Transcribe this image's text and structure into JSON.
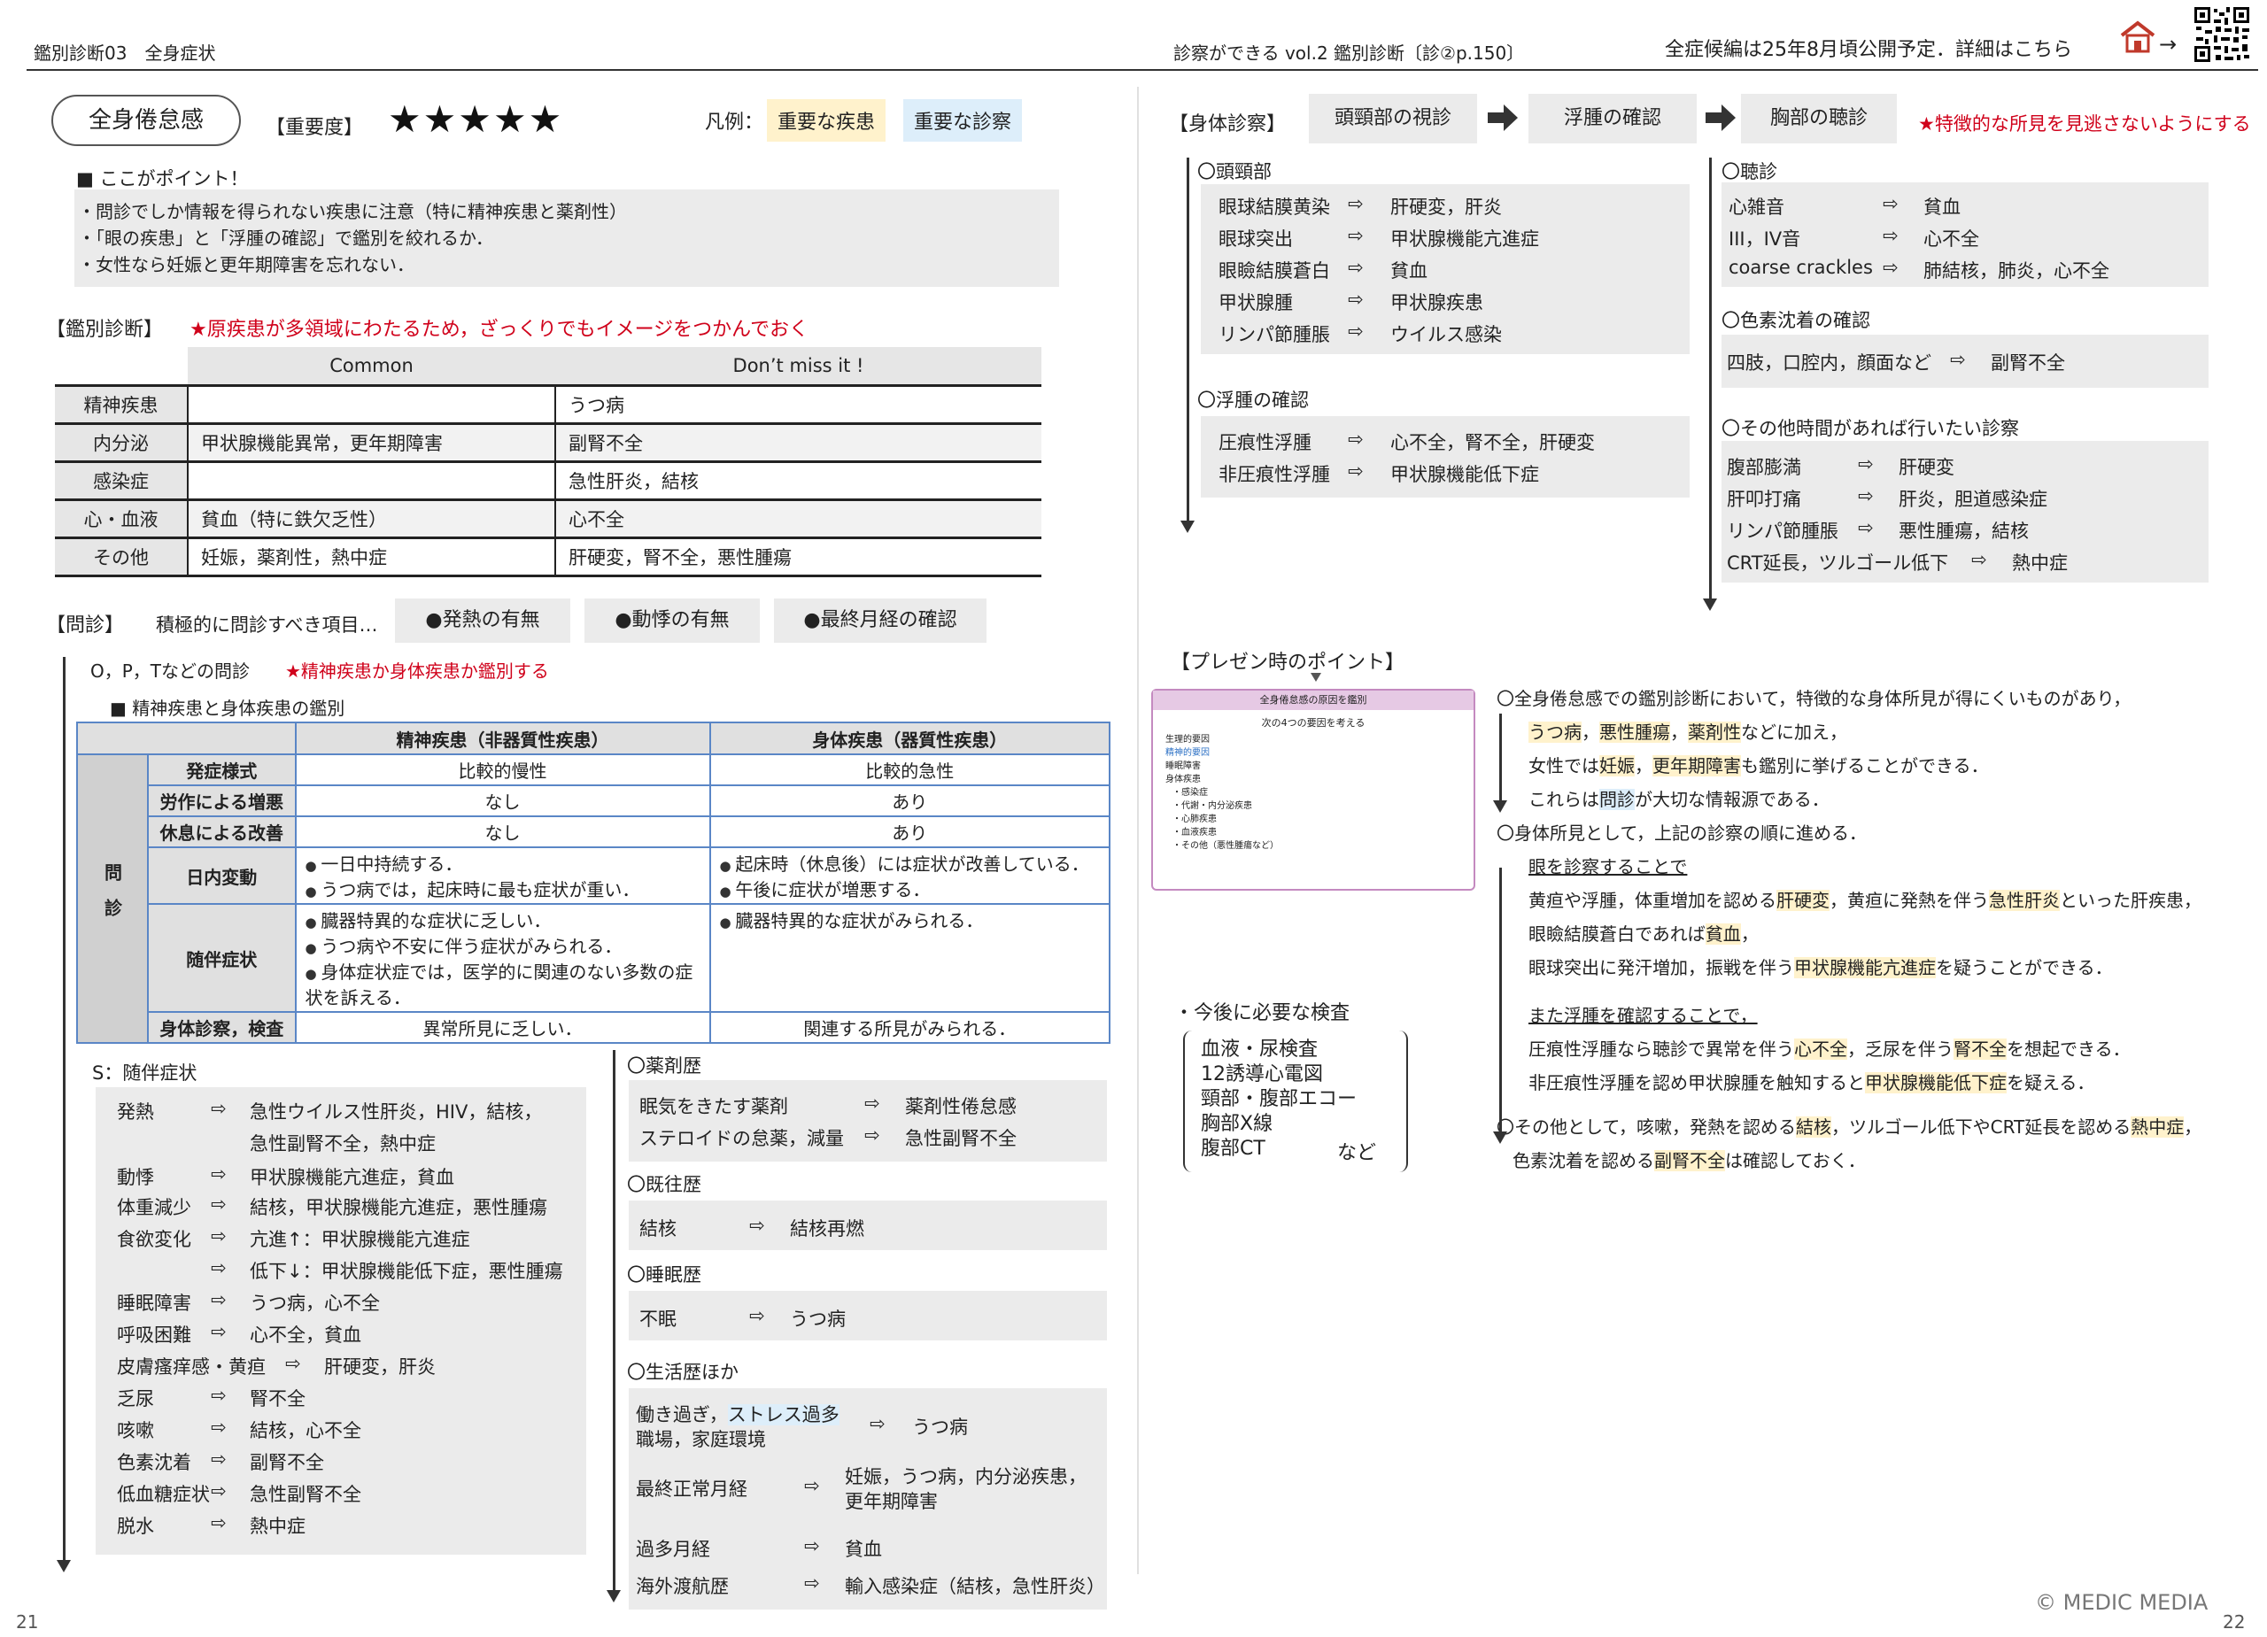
{
  "header": {
    "left": "鑑別診断03　全身症状",
    "center": "診察ができる vol.2 鑑別診断〔診②p.150〕",
    "right": "全症候編は25年8月頃公開予定．詳細はこちら",
    "arrow": "→",
    "qr_icon": "qr-code-icon",
    "logo_icon": "house-logo-icon"
  },
  "title": {
    "name": "全身倦怠感",
    "importance_label": "【重要度】",
    "stars": "★★★★★",
    "legend_label": "凡例：",
    "legend_disease": "重要な疾患",
    "legend_exam": "重要な診察"
  },
  "points": {
    "heading": "■ ここがポイント！",
    "items": [
      "・問診でしか情報を得られない疾患に注意（特に精神疾患と薬剤性）",
      "・「眼の疾患」と「浮腫の確認」で鑑別を絞れるか．",
      "・女性なら妊娠と更年期障害を忘れない．"
    ]
  },
  "ddx": {
    "heading": "【鑑別診断】",
    "note": "★原疾患が多領域にわたるため，ざっくりでもイメージをつかんでおく",
    "col_common": "Common",
    "col_dontmiss": "Don’t miss it !",
    "rows": [
      {
        "cat": "精神疾患",
        "common": "",
        "dontmiss": "うつ病"
      },
      {
        "cat": "内分泌",
        "common": "甲状腺機能異常，更年期障害",
        "dontmiss": "副腎不全"
      },
      {
        "cat": "感染症",
        "common": "",
        "dontmiss": "急性肝炎，結核"
      },
      {
        "cat": "心・血液",
        "common": "貧血（特に鉄欠乏性）",
        "dontmiss": "心不全"
      },
      {
        "cat": "その他",
        "common": "妊娠，薬剤性，熱中症",
        "dontmiss": "肝硬変，腎不全，悪性腫瘍"
      }
    ]
  },
  "interview": {
    "heading": "【問診】",
    "lead": "積極的に問診すべき項目…",
    "items": [
      "●発熱の有無",
      "●動悸の有無",
      "●最終月経の確認"
    ],
    "opqrst": "O，P，Tなどの問診",
    "opqrst_note": "★精神疾患か身体疾患か鑑別する",
    "subheading": "■ 精神疾患と身体疾患の鑑別"
  },
  "psy_table": {
    "col_psy": "精神疾患（非器質性疾患）",
    "col_body": "身体疾患（器質性疾患）",
    "group_label": "問診",
    "rows": [
      {
        "label": "発症様式",
        "psy": "比較的慢性",
        "body": "比較的急性"
      },
      {
        "label": "労作による増悪",
        "psy": "なし",
        "body": "あり"
      },
      {
        "label": "休息による改善",
        "psy": "なし",
        "body": "あり"
      }
    ],
    "diurnal": {
      "label": "日内変動",
      "psy": [
        "一日中持続する．",
        "うつ病では，起床時に最も症状が重い．"
      ],
      "body": [
        "起床時（休息後）には症状が改善している．",
        "午後に症状が増悪する．"
      ]
    },
    "associated": {
      "label": "随伴症状",
      "psy": [
        "臓器特異的な症状に乏しい．",
        "うつ病や不安に伴う症状がみられる．",
        "身体症状症では，医学的に関連のない多数の症状を訴える．"
      ],
      "body": [
        "臓器特異的な症状がみられる．"
      ]
    },
    "exam": {
      "label": "身体診察，検査",
      "psy": "異常所見に乏しい．",
      "body": "関連する所見がみられる．"
    }
  },
  "symptoms": {
    "heading": "S：随伴症状",
    "arrow": "⇨",
    "rows": [
      {
        "k": "発熱",
        "v": "急性ウイルス性肝炎，HIV，結核，"
      },
      {
        "k": "",
        "v": "急性副腎不全，熱中症"
      },
      {
        "k": "動悸",
        "v": "甲状腺機能亢進症，貧血"
      },
      {
        "k": "体重減少",
        "v": "結核，甲状腺機能亢進症，悪性腫瘍"
      },
      {
        "k": "食欲変化",
        "v": "亢進↑：甲状腺機能亢進症"
      },
      {
        "k": "",
        "v": "低下↓：甲状腺機能低下症，悪性腫瘍"
      },
      {
        "k": "睡眠障害",
        "v": "うつ病，心不全"
      },
      {
        "k": "呼吸困難",
        "v": "心不全，貧血"
      },
      {
        "k": "皮膚瘙痒感・黄疸",
        "v": "肝硬変，肝炎"
      },
      {
        "k": "乏尿",
        "v": "腎不全"
      },
      {
        "k": "咳嗽",
        "v": "結核，心不全"
      },
      {
        "k": "色素沈着",
        "v": "副腎不全"
      },
      {
        "k": "低血糖症状",
        "v": "急性副腎不全"
      },
      {
        "k": "脱水",
        "v": "熱中症"
      }
    ]
  },
  "history": {
    "drug_h": "〇薬剤歴",
    "drug": [
      {
        "k": "眠気をきたす薬剤",
        "v": "薬剤性倦怠感"
      },
      {
        "k": "ステロイドの怠薬，減量",
        "v": "急性副腎不全"
      }
    ],
    "past_h": "〇既往歴",
    "past": [
      {
        "k": "結核",
        "v": "結核再燃"
      }
    ],
    "sleep_h": "〇睡眠歴",
    "sleep": [
      {
        "k": "不眠",
        "v": "うつ病"
      }
    ],
    "life_h": "〇生活歴ほか",
    "life1_a": "働き過ぎ，",
    "life1_b": "ストレス過多",
    "life1_c": "職場，家庭環境",
    "life1_v": "うつ病",
    "life2_k": "最終正常月経",
    "life2_v1": "妊娠，うつ病，内分泌疾患，",
    "life2_v2": "更年期障害",
    "life3_k": "過多月経",
    "life3_v": "貧血",
    "life4_k": "海外渡航歴",
    "life4_v": "輸入感染症（結核，急性肝炎）"
  },
  "exam": {
    "heading": "【身体診察】",
    "steps": [
      "頭頸部の視診",
      "浮腫の確認",
      "胸部の聴診"
    ],
    "note": "★特徴的な所見を見逃さないようにする",
    "head_h": "〇頭頸部",
    "head": [
      {
        "k": "眼球結膜黄染",
        "v": "肝硬変，肝炎"
      },
      {
        "k": "眼球突出",
        "v": "甲状腺機能亢進症"
      },
      {
        "k": "眼瞼結膜蒼白",
        "v": "貧血"
      },
      {
        "k": "甲状腺腫",
        "v": "甲状腺疾患"
      },
      {
        "k": "リンパ節腫脹",
        "v": "ウイルス感染"
      }
    ],
    "edema_h": "〇浮腫の確認",
    "edema": [
      {
        "k": "圧痕性浮腫",
        "v": "心不全，腎不全，肝硬変"
      },
      {
        "k": "非圧痕性浮腫",
        "v": "甲状腺機能低下症"
      }
    ],
    "ausc_h": "〇聴診",
    "ausc": [
      {
        "k": "心雑音",
        "v": "貧血"
      },
      {
        "k": "III，IV音",
        "v": "心不全"
      },
      {
        "k": "coarse crackles",
        "v": "肺結核，肺炎，心不全"
      }
    ],
    "pig_h": "〇色素沈着の確認",
    "pig": {
      "k": "四肢，口腔内，顔面など",
      "v": "副腎不全"
    },
    "other_h": "〇その他時間があれば行いたい診察",
    "other": [
      {
        "k": "腹部膨満",
        "v": "肝硬変"
      },
      {
        "k": "肝叩打痛",
        "v": "肝炎，胆道感染症"
      },
      {
        "k": "リンパ節腫脹",
        "v": "悪性腫瘍，結核"
      },
      {
        "k": "CRT延長，ツルゴール低下",
        "v": "熱中症"
      }
    ]
  },
  "presen": {
    "heading": "【プレゼン時のポイント】",
    "slide_title": "全身倦怠感の原因を鑑別",
    "slide_sub": "次の4つの要因を考える",
    "slide_items": [
      "生理的要因",
      "精神的要因",
      "睡眠障害",
      "身体疾患",
      "・感染症",
      "・代謝・内分泌疾患",
      "・心肺疾患",
      "・血液疾患",
      "・その他（悪性腫瘍など）"
    ],
    "p1_a": "〇全身倦怠感での鑑別診断において，特徴的な身体所見が得にくいものがあり，",
    "p1_b1": "うつ病",
    "p1_b2": "悪性腫瘍",
    "p1_b3": "薬剤性",
    "p1_b4": "などに加え，",
    "p1_c1": "女性では",
    "p1_c2": "妊娠",
    "p1_c3": "更年期障害",
    "p1_c4": "も鑑別に挙げることができる．",
    "p1_d1": "これらは",
    "p1_d2": "問診",
    "p1_d3": "が大切な情報源である．",
    "p2_a": "〇身体所見として，上記の診察の順に進める．",
    "p2_b": "眼を診察することで",
    "p2_c1": "黄疸や浮腫，体重増加を認める",
    "p2_c2": "肝硬変",
    "p2_c3": "，",
    "p2_c4": "黄疸に発熱を伴う",
    "p2_c5": "急性肝炎",
    "p2_c6": "といった肝疾患，",
    "p2_d1": "眼瞼結膜蒼白であれば",
    "p2_d2": "貧血",
    "p2_d3": "，",
    "p2_e1": "眼球突出に発汗増加，振戦を伴う",
    "p2_e2": "甲状腺機能亢進症",
    "p2_e3": "を疑うことができる．",
    "p2_f": "また浮腫を確認することで，",
    "p2_g1": "圧痕性浮腫なら聴診で異常を伴う",
    "p2_g2": "心不全",
    "p2_g3": "，乏尿を伴う",
    "p2_g4": "腎不全",
    "p2_g5": "を想起できる．",
    "p2_h1": "非圧痕性浮腫を認め甲状腺腫を触知すると",
    "p2_h2": "甲状腺機能低下症",
    "p2_h3": "を疑える．",
    "p3_a1": "〇その他として，咳嗽，発熱を認める",
    "p3_a2": "結核",
    "p3_a3": "，ツルゴール低下やCRT延長を認める",
    "p3_a4": "熱中症",
    "p3_a5": "，",
    "p3_b1": "色素沈着を認める",
    "p3_b2": "副腎不全",
    "p3_b3": "は確認しておく．"
  },
  "tests": {
    "heading": "・今後に必要な検査",
    "items": [
      "血液・尿検査",
      "12誘導心電図",
      "頸部・腹部エコー",
      "胸部X線",
      "腹部CT"
    ],
    "etc": "など"
  },
  "footer": {
    "page_left": "21",
    "page_right": "22",
    "copyright": "© MEDIC MEDIA"
  }
}
